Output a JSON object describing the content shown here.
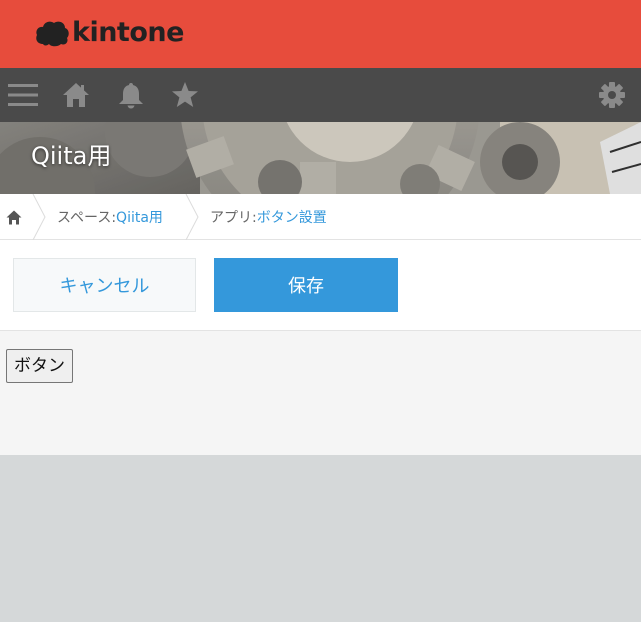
{
  "brand": {
    "name": "kintone",
    "color": "#e74c3c"
  },
  "nav": {
    "background": "#4a4a4a",
    "icons": [
      "menu-icon",
      "home-icon",
      "bell-icon",
      "star-icon",
      "gear-icon"
    ]
  },
  "space": {
    "title": "Qiita用"
  },
  "breadcrumb": {
    "space_prefix": "スペース: ",
    "space_name": "Qiita用",
    "app_prefix": "アプリ: ",
    "app_name": "ボタン設置"
  },
  "actions": {
    "cancel_label": "キャンセル",
    "save_label": "保存",
    "accent": "#3498db"
  },
  "content": {
    "custom_button_label": "ボタン"
  }
}
